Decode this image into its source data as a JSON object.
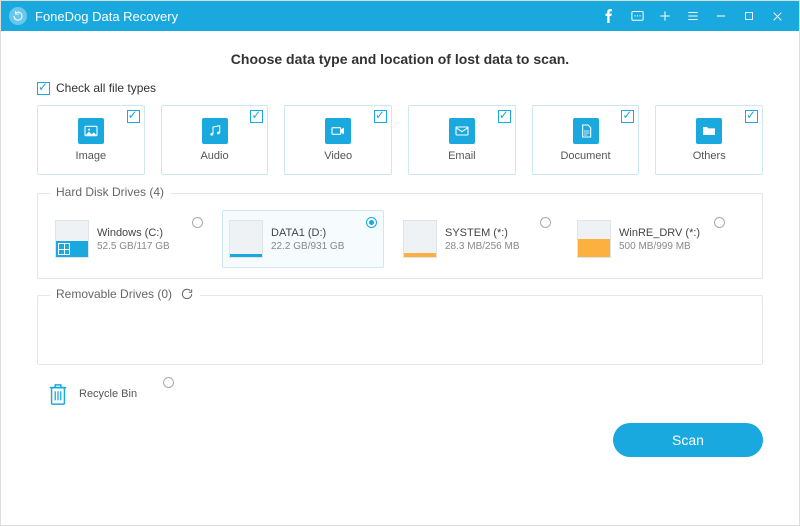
{
  "app": {
    "title": "FoneDog Data Recovery"
  },
  "heading": "Choose data type and location of lost data to scan.",
  "check_all_label": "Check all file types",
  "types": [
    {
      "key": "image",
      "label": "Image"
    },
    {
      "key": "audio",
      "label": "Audio"
    },
    {
      "key": "video",
      "label": "Video"
    },
    {
      "key": "email",
      "label": "Email"
    },
    {
      "key": "document",
      "label": "Document"
    },
    {
      "key": "others",
      "label": "Others"
    }
  ],
  "sections": {
    "hdd": {
      "title": "Hard Disk Drives (4)"
    },
    "removable": {
      "title": "Removable Drives (0)"
    }
  },
  "drives": [
    {
      "name": "Windows (C:)",
      "size": "52.5 GB/117 GB",
      "fill_pct": 45,
      "color": "blue",
      "os": true,
      "selected": false
    },
    {
      "name": "DATA1 (D:)",
      "size": "22.2 GB/931 GB",
      "fill_pct": 8,
      "color": "blue",
      "os": false,
      "selected": true
    },
    {
      "name": "SYSTEM (*:)",
      "size": "28.3 MB/256 MB",
      "fill_pct": 12,
      "color": "orange",
      "os": false,
      "selected": false
    },
    {
      "name": "WinRE_DRV (*:)",
      "size": "500 MB/999 MB",
      "fill_pct": 50,
      "color": "orange",
      "os": false,
      "selected": false
    }
  ],
  "recycle_bin": {
    "label": "Recycle Bin"
  },
  "scan_button": "Scan"
}
